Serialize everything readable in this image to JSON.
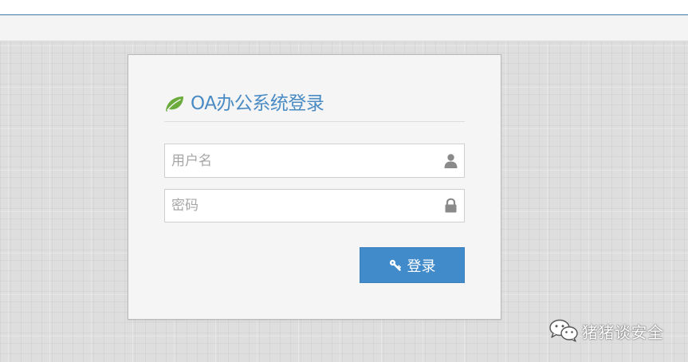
{
  "login": {
    "title": "OA办公系统登录",
    "username_placeholder": "用户名",
    "password_placeholder": "密码",
    "submit_label": "登录"
  },
  "watermark": {
    "text": "猪猪谈安全"
  },
  "icons": {
    "title": "leaf-icon",
    "username": "user-icon",
    "password": "lock-icon",
    "submit": "key-icon",
    "watermark": "wechat-icon"
  },
  "colors": {
    "accent": "#428bca",
    "title": "#4a8bc4",
    "leaf": "#6aab3c",
    "field_icon": "#8a8a8a",
    "background": "#dedede"
  }
}
